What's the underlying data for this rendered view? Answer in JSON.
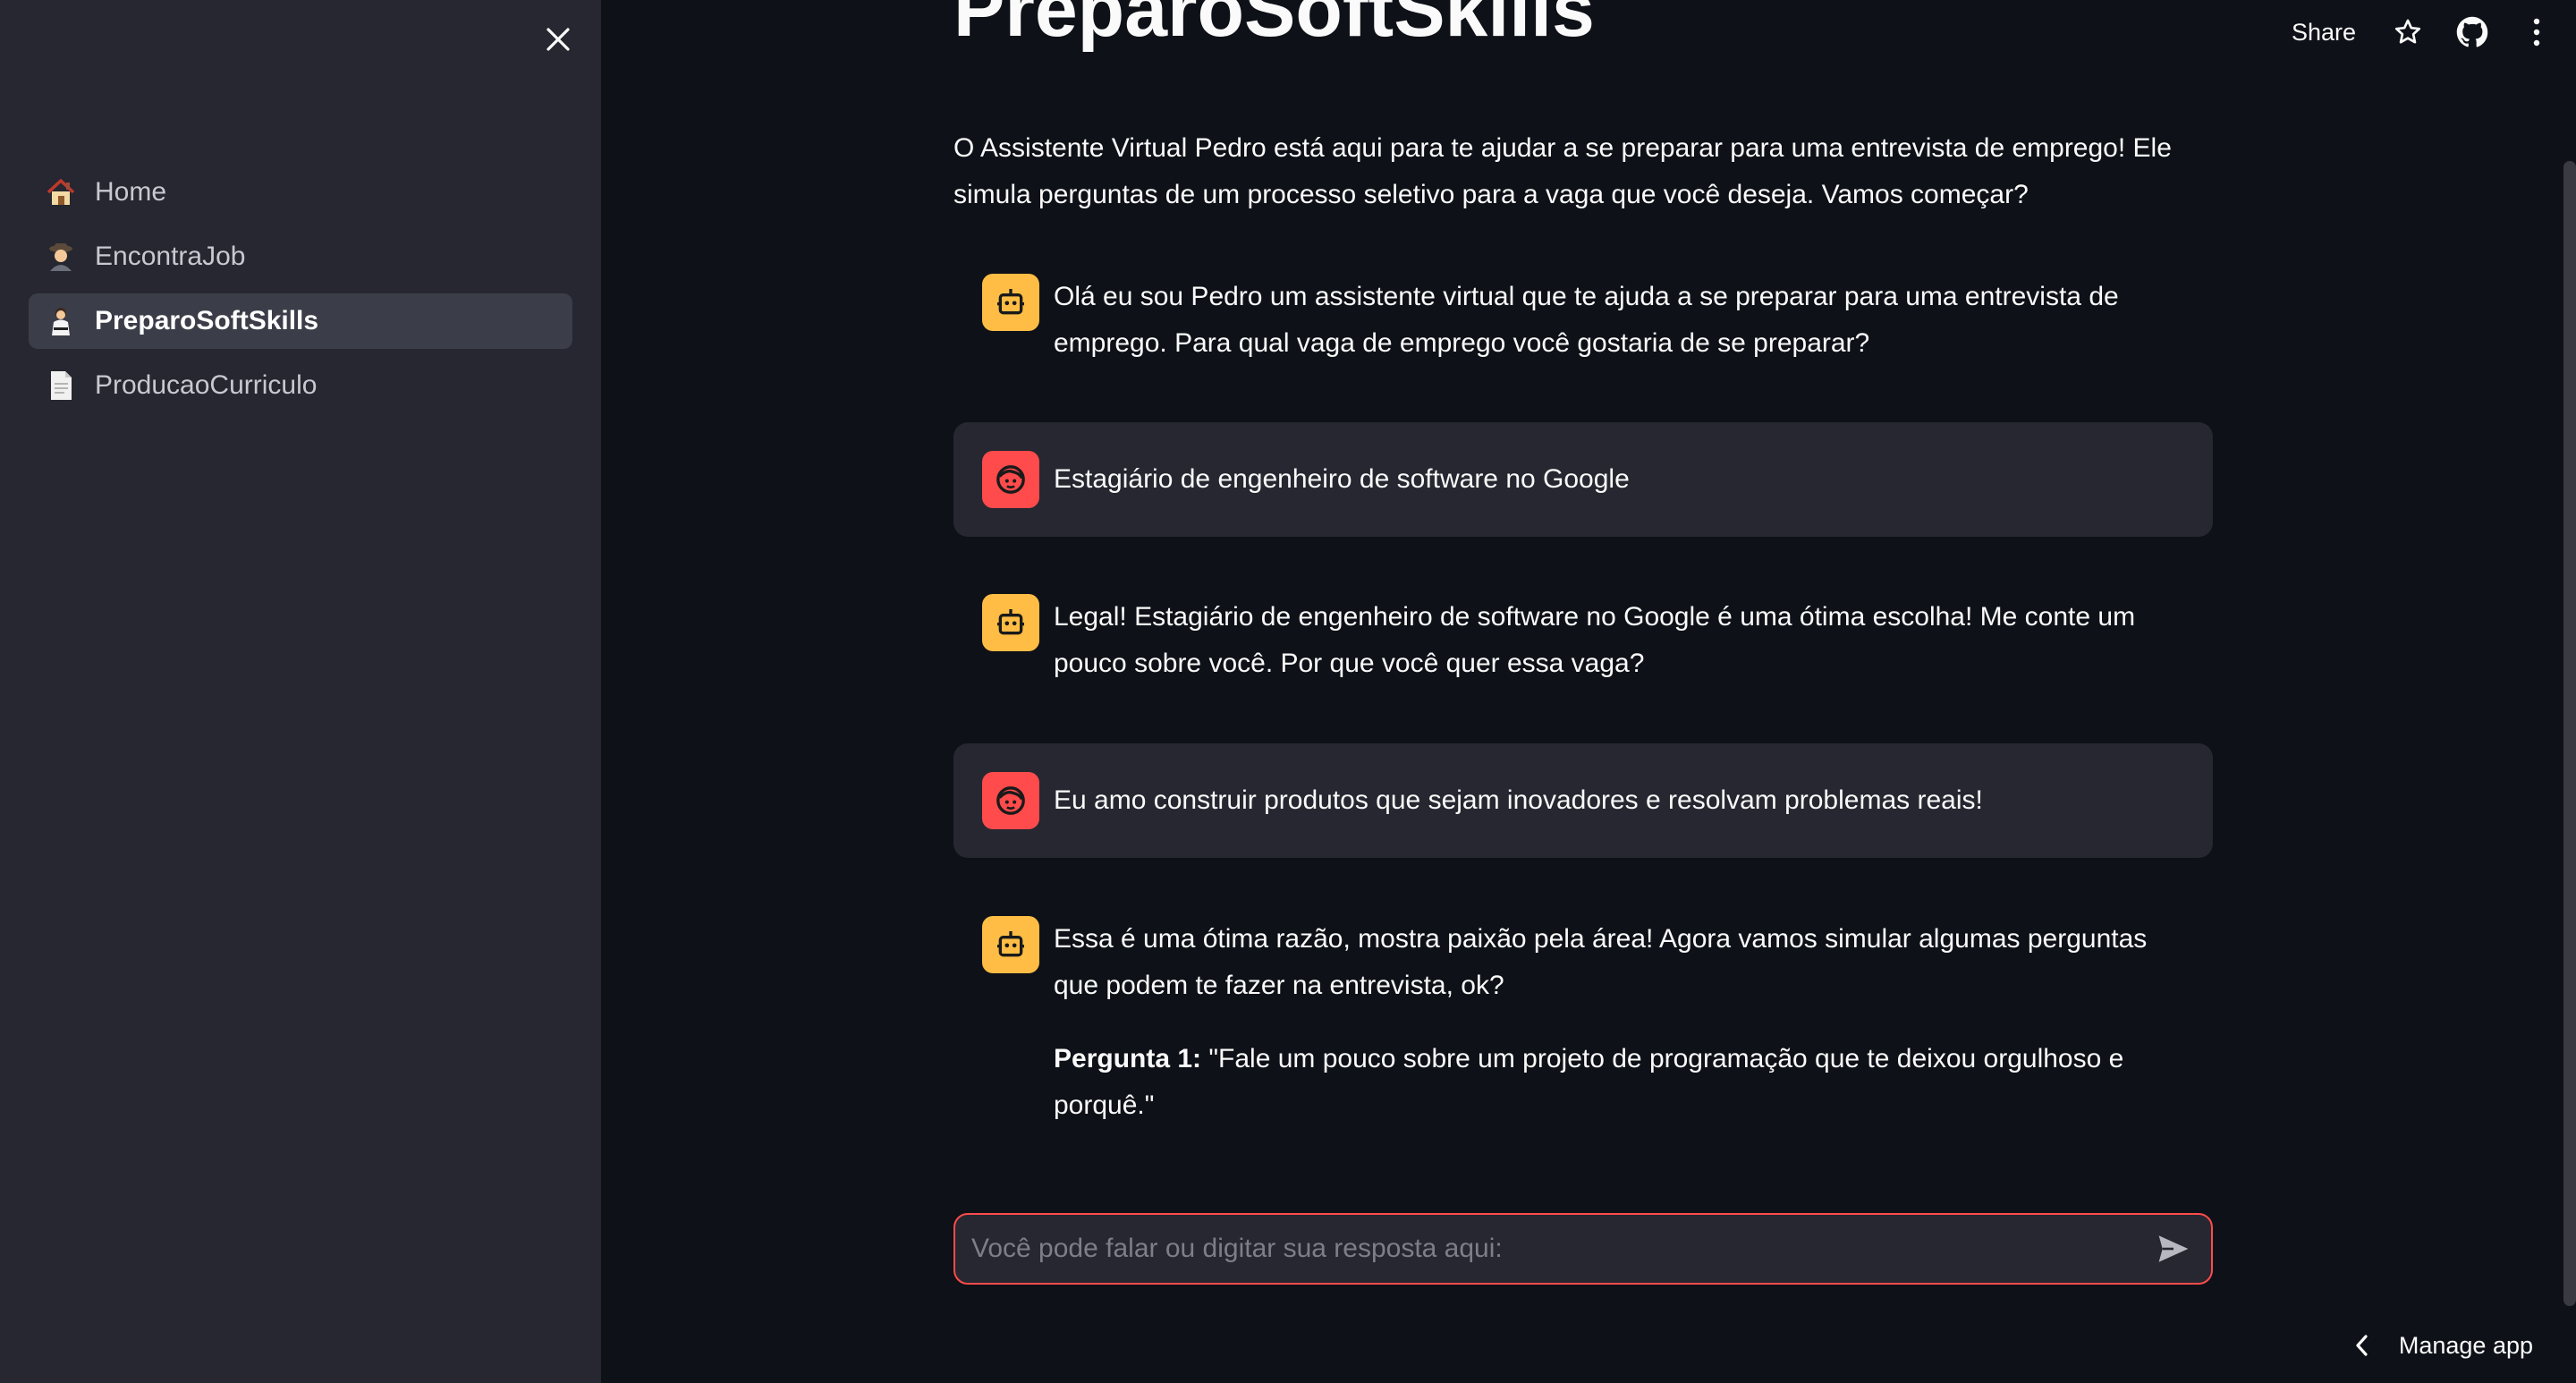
{
  "sidebar": {
    "close_icon": "close-icon",
    "items": [
      {
        "label": "Home",
        "icon": "house-emoji-icon"
      },
      {
        "label": "EncontraJob",
        "icon": "detective-emoji-icon"
      },
      {
        "label": "PreparoSoftSkills",
        "icon": "judo-emoji-icon",
        "active": true
      },
      {
        "label": "ProducaoCurriculo",
        "icon": "document-icon"
      }
    ]
  },
  "header": {
    "share_label": "Share",
    "icons": [
      "star-icon",
      "github-icon",
      "more-vertical-icon"
    ]
  },
  "page": {
    "title": "PreparoSoftSkills",
    "intro": "O Assistente Virtual Pedro está aqui para te ajudar a se preparar para uma entrevista de emprego! Ele simula perguntas de um processo seletivo para a vaga que você deseja. Vamos começar?"
  },
  "messages": [
    {
      "role": "assistant",
      "text": "Olá eu sou Pedro um assistente virtual que te ajuda a se preparar para uma entrevista de emprego. Para qual vaga de emprego você gostaria de se preparar?"
    },
    {
      "role": "user",
      "text": "Estagiário de engenheiro de software no Google"
    },
    {
      "role": "assistant",
      "text": "Legal! Estagiário de engenheiro de software no Google é uma ótima escolha! Me conte um pouco sobre você. Por que você quer essa vaga?"
    },
    {
      "role": "user",
      "text": "Eu amo construir produtos que sejam inovadores e resolvam problemas reais!"
    },
    {
      "role": "assistant",
      "text": "Essa é uma ótima razão, mostra paixão pela área! Agora vamos simular algumas perguntas que podem te fazer na entrevista, ok?",
      "bold_label": "Pergunta 1:",
      "after_bold": " \"Fale um pouco sobre um projeto de programação que te deixou orgulhoso e porquê.\""
    }
  ],
  "chat_input": {
    "placeholder": "Você pode falar ou digitar sua resposta aqui:",
    "value": ""
  },
  "footer": {
    "manage_label": "Manage app"
  },
  "colors": {
    "background": "#0e1117",
    "sidebar": "#262730",
    "bot_avatar": "#ffbd45",
    "user_avatar": "#ff4b4b",
    "accent": "#ff4b4b"
  }
}
